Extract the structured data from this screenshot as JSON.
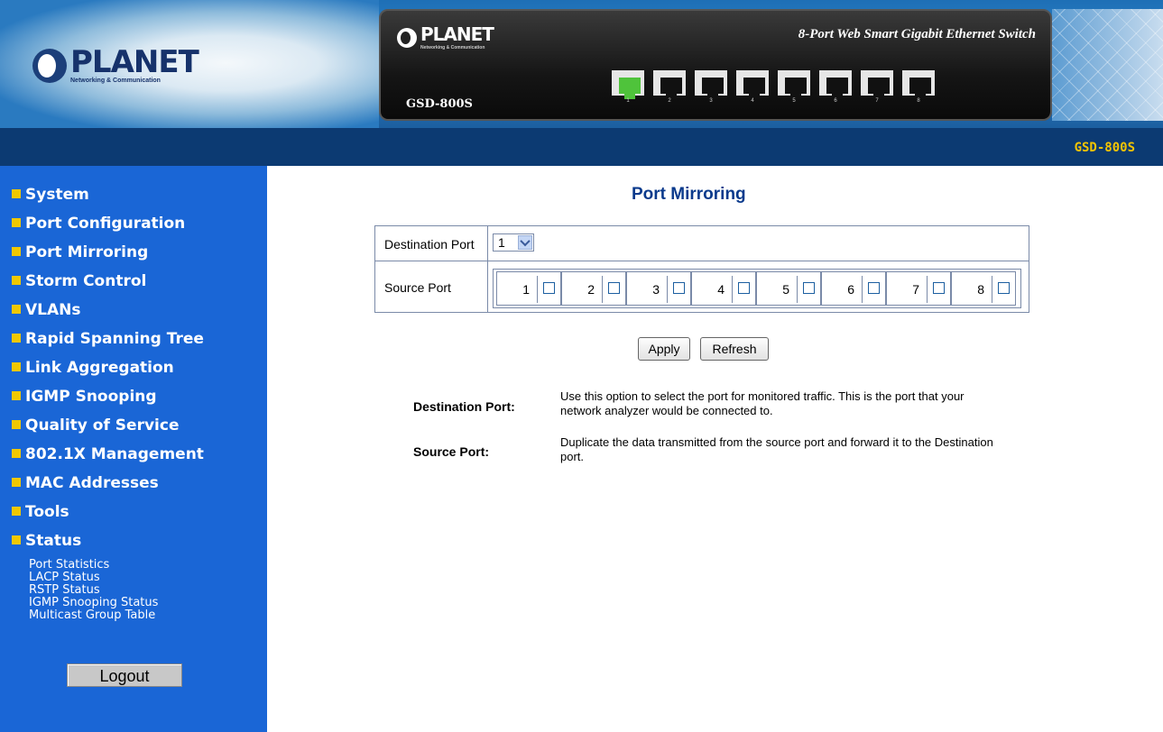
{
  "banner": {
    "logo_text": "PLANET",
    "logo_sub": "Networking & Communication",
    "device_logo_text": "PLANET",
    "device_logo_sub": "Networking & Communication",
    "device_model": "GSD-800S",
    "device_desc": "8-Port Web Smart Gigabit Ethernet Switch",
    "ports": [
      "1",
      "2",
      "3",
      "4",
      "5",
      "6",
      "7",
      "8"
    ],
    "active_port": "1"
  },
  "topbar": {
    "model": "GSD-800S"
  },
  "sidebar": {
    "items": [
      {
        "label": "System"
      },
      {
        "label": "Port Configuration"
      },
      {
        "label": "Port Mirroring"
      },
      {
        "label": "Storm Control"
      },
      {
        "label": "VLANs"
      },
      {
        "label": "Rapid Spanning Tree"
      },
      {
        "label": "Link Aggregation"
      },
      {
        "label": "IGMP Snooping"
      },
      {
        "label": "Quality of Service"
      },
      {
        "label": "802.1X Management"
      },
      {
        "label": "MAC Addresses"
      },
      {
        "label": "Tools"
      },
      {
        "label": "Status"
      }
    ],
    "status_sub": [
      {
        "label": "Port Statistics"
      },
      {
        "label": "LACP Status"
      },
      {
        "label": "RSTP Status"
      },
      {
        "label": "IGMP Snooping Status"
      },
      {
        "label": "Multicast Group Table"
      }
    ],
    "logout_label": "Logout"
  },
  "main": {
    "title": "Port Mirroring",
    "destination_label": "Destination Port",
    "destination_value": "1",
    "source_label": "Source Port",
    "source_ports": [
      "1",
      "2",
      "3",
      "4",
      "5",
      "6",
      "7",
      "8"
    ],
    "apply_label": "Apply",
    "refresh_label": "Refresh",
    "help": [
      {
        "term": "Destination Port:",
        "desc": "Use this option to select the port for monitored traffic. This is the port that your network analyzer would be connected to."
      },
      {
        "term": "Source Port:",
        "desc": "Duplicate the data transmitted from the source port and forward it to the Destination port."
      }
    ]
  },
  "colors": {
    "sidebar_bg": "#1a66d6",
    "topbar_bg": "#0c3a72",
    "accent_yellow": "#f0c800",
    "title_blue": "#0a3a8c"
  }
}
